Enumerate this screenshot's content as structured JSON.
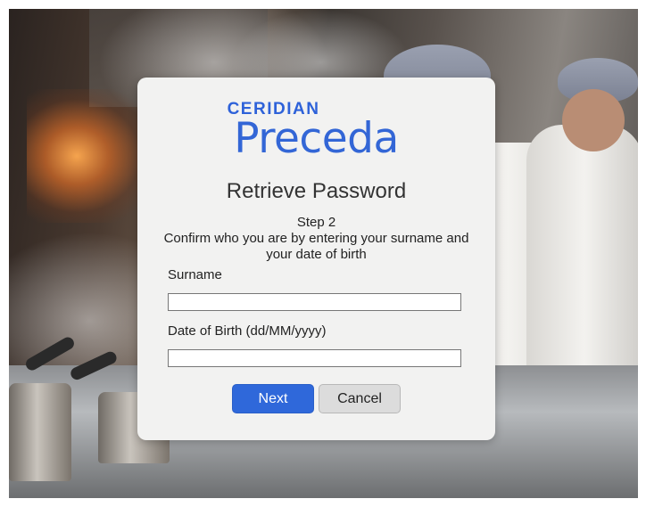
{
  "brand": {
    "company": "CERIDIAN",
    "product": "Preceda",
    "color": "#2e62d9"
  },
  "form": {
    "title": "Retrieve Password",
    "step": "Step 2",
    "instructions": "Confirm who you are by entering your surname and your date of birth",
    "surname": {
      "label": "Surname",
      "value": "",
      "placeholder": ""
    },
    "dob": {
      "label": "Date of Birth (dd/MM/yyyy)",
      "value": "",
      "placeholder": ""
    },
    "next_label": "Next",
    "cancel_label": "Cancel"
  },
  "colors": {
    "primary_button": "#2f68da",
    "secondary_button": "#dcdcdc",
    "card_background": "#f2f2f1"
  }
}
